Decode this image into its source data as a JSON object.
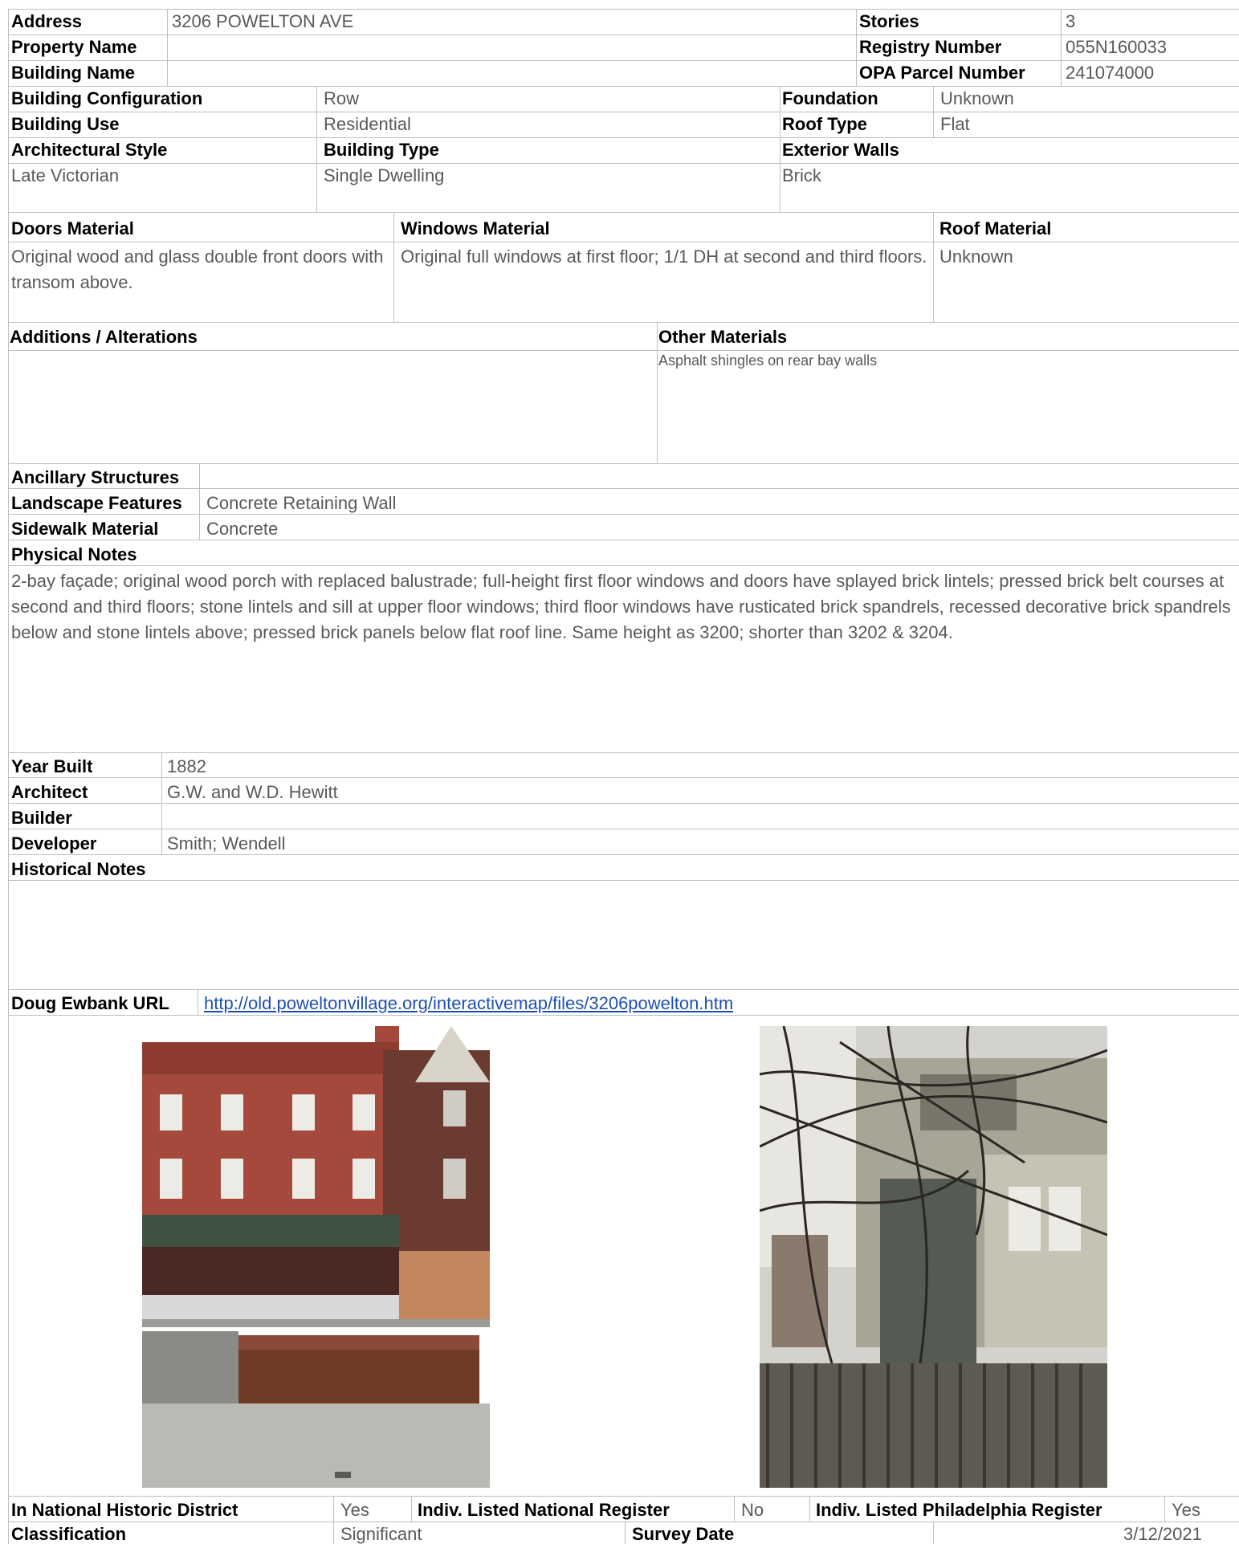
{
  "header": {
    "address_label": "Address",
    "address": "3206 POWELTON AVE",
    "stories_label": "Stories",
    "stories": "3",
    "property_name_label": "Property Name",
    "property_name": "",
    "registry_label": "Registry Number",
    "registry": "055N160033",
    "building_name_label": "Building Name",
    "building_name": "",
    "opa_label": "OPA Parcel Number",
    "opa": "241074000"
  },
  "config": {
    "configuration_label": "Building Configuration",
    "configuration": "Row",
    "foundation_label": "Foundation",
    "foundation": "Unknown",
    "use_label": "Building Use",
    "use": "Residential",
    "roof_type_label": "Roof Type",
    "roof_type": "Flat",
    "style_label": "Architectural Style",
    "style": "Late Victorian",
    "type_label": "Building Type",
    "type": "Single Dwelling",
    "walls_label": "Exterior Walls",
    "walls": "Brick"
  },
  "materials": {
    "doors_label": "Doors Material",
    "doors": "Original wood and glass double front doors with transom above.",
    "windows_label": "Windows Material",
    "windows": "Original full windows at first floor; 1/1 DH at second and third floors.",
    "roof_label": "Roof Material",
    "roof": "Unknown"
  },
  "additions": {
    "additions_label": "Additions / Alterations",
    "additions": "",
    "other_label": "Other Materials",
    "other": "Asphalt shingles on rear bay walls"
  },
  "site": {
    "ancillary_label": "Ancillary Structures",
    "ancillary": "",
    "landscape_label": "Landscape Features",
    "landscape": "Concrete Retaining Wall",
    "sidewalk_label": "Sidewalk Material",
    "sidewalk": "Concrete"
  },
  "physical": {
    "label": "Physical Notes",
    "text": "2-bay façade; original wood porch with replaced balustrade; full-height first floor windows and doors have splayed brick lintels; pressed brick belt courses at second and third floors; stone lintels and sill at upper floor windows; third floor windows have rusticated brick spandrels, recessed decorative brick spandrels below and stone lintels above; pressed brick panels below flat roof line. Same height as 3200; shorter than 3202 & 3204."
  },
  "history": {
    "year_label": "Year Built",
    "year": "1882",
    "architect_label": "Architect",
    "architect": "G.W. and W.D. Hewitt",
    "builder_label": "Builder",
    "builder": "",
    "developer_label": "Developer",
    "developer": "Smith; Wendell",
    "notes_label": "Historical Notes",
    "notes": ""
  },
  "link": {
    "label": "Doug Ewbank URL",
    "url": "http://old.poweltonvillage.org/interactivemap/files/3206powelton.htm"
  },
  "footer": {
    "district_label": "In National Historic District",
    "district": "Yes",
    "national_label": "Indiv. Listed National Register",
    "national": "No",
    "phila_label": "Indiv. Listed Philadelphia Register",
    "phila": "Yes",
    "classification_label": "Classification",
    "classification": "Significant",
    "survey_label": "Survey Date",
    "survey": "3/12/2021"
  }
}
